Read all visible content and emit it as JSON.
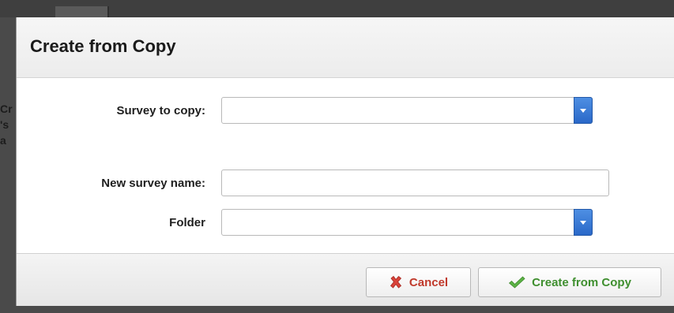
{
  "dialog": {
    "title": "Create from Copy"
  },
  "form": {
    "survey_to_copy": {
      "label": "Survey to copy:",
      "value": ""
    },
    "new_survey_name": {
      "label": "New survey name:",
      "value": ""
    },
    "folder": {
      "label": "Folder",
      "value": ""
    }
  },
  "footer": {
    "cancel_label": "Cancel",
    "create_label": "Create from Copy"
  },
  "colors": {
    "select_button": "#3a7bd5",
    "cancel_text": "#c0392b",
    "create_text": "#3f8f2f"
  },
  "icons": {
    "cancel": "close-icon",
    "create": "check-icon",
    "dropdown": "chevron-down-icon"
  }
}
